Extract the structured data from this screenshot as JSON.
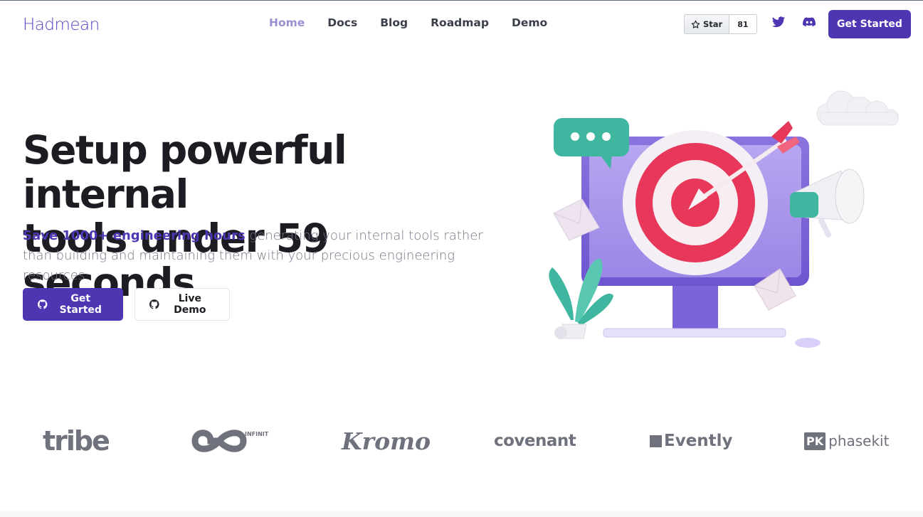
{
  "header": {
    "logo": "Hadmean",
    "nav": [
      {
        "label": "Home",
        "active": true
      },
      {
        "label": "Docs",
        "active": false
      },
      {
        "label": "Blog",
        "active": false
      },
      {
        "label": "Roadmap",
        "active": false
      },
      {
        "label": "Demo",
        "active": false
      }
    ],
    "github_star": {
      "label": "Star",
      "count": "81"
    },
    "social": [
      "twitter-icon",
      "discord-icon"
    ],
    "cta_label": "Get Started"
  },
  "hero": {
    "title_line1": "Setup powerful internal",
    "title_line2": "tools under 59 seconds",
    "subtitle_highlight": "Save 1000+ engineering hours",
    "subtitle_rest": " generating your internal tools rather than building and maintaining them with your precious engineering resources.",
    "primary_button": "Get Started",
    "secondary_button": "Live Demo"
  },
  "brands": [
    {
      "name": "tribe"
    },
    {
      "name": "INFINITE"
    },
    {
      "name": "Kromo"
    },
    {
      "name": "covenant"
    },
    {
      "name": "Evently"
    },
    {
      "name": "phasekit",
      "badge": "PK"
    }
  ],
  "colors": {
    "brand": "#4e36b3",
    "nav_active": "#9a8fd2",
    "text_dark": "#1c1c22",
    "text_muted": "#737785",
    "logo_gray": "#6f727d"
  }
}
